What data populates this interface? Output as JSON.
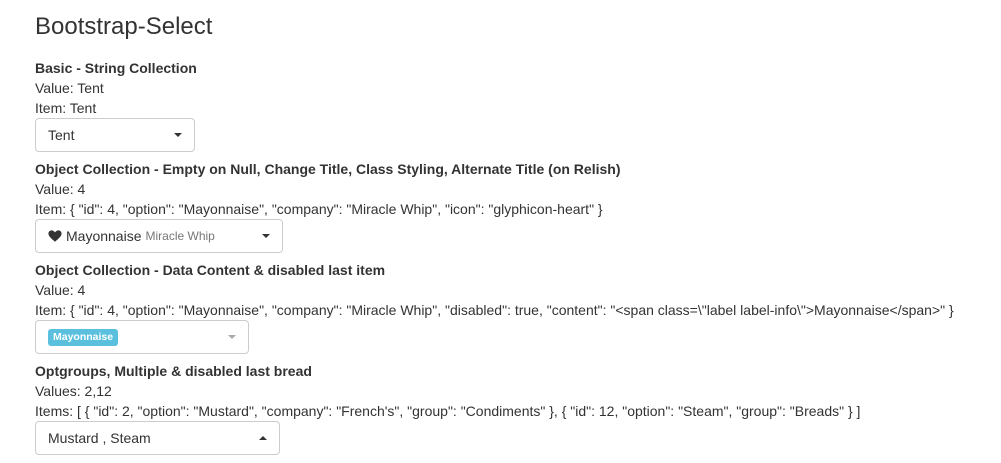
{
  "page": {
    "title": "Bootstrap-Select"
  },
  "sections": [
    {
      "title": "Basic - String Collection",
      "value_line": "Value: Tent",
      "item_line": "Item: Tent",
      "select": {
        "label": "Tent"
      }
    },
    {
      "title": "Object Collection - Empty on Null, Change Title, Class Styling, Alternate Title (on Relish)",
      "value_line": "Value: 4",
      "item_line": "Item: { \"id\": 4, \"option\": \"Mayonnaise\", \"company\": \"Miracle Whip\", \"icon\": \"glyphicon-heart\" }",
      "select": {
        "label": "Mayonnaise",
        "subtext": "Miracle Whip",
        "icon": "heart-icon"
      }
    },
    {
      "title": "Object Collection - Data Content & disabled last item",
      "value_line": "Value: 4",
      "item_line": "Item: { \"id\": 4, \"option\": \"Mayonnaise\", \"company\": \"Miracle Whip\", \"disabled\": true, \"content\": \"<span class=\\\"label label-info\\\">Mayonnaise</span>\" }",
      "select": {
        "label": "Mayonnaise",
        "badge_color": "#5bc0de"
      }
    },
    {
      "title": "Optgroups, Multiple & disabled last bread",
      "value_line": "Values: 2,12",
      "item_line": "Items: [ { \"id\": 2, \"option\": \"Mustard\", \"company\": \"French's\", \"group\": \"Condiments\" }, { \"id\": 12, \"option\": \"Steam\", \"group\": \"Breads\" } ]",
      "select": {
        "label": "Mustard , Steam",
        "open": true
      }
    }
  ]
}
